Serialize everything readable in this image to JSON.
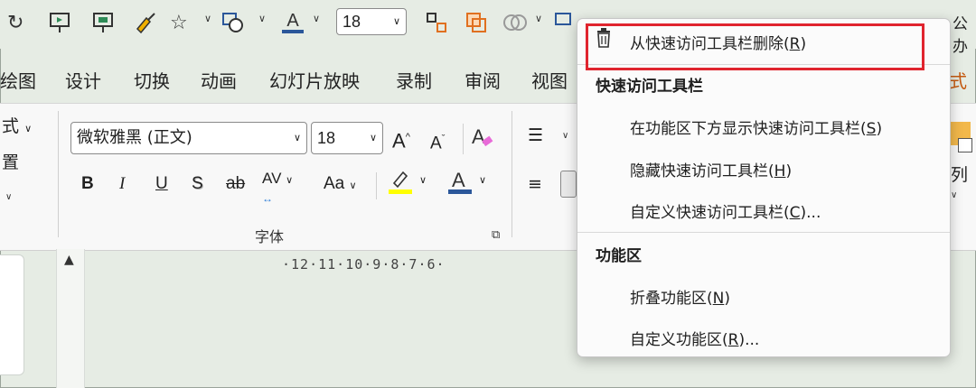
{
  "qat": {
    "font_size": "18",
    "icons": [
      "repeat-icon",
      "present-from-start-icon",
      "present-from-current-icon",
      "format-painter-icon",
      "shapes-icon",
      "shape-fill-icon",
      "font-color-icon",
      "arrange-icon",
      "bring-forward-icon",
      "merge-shapes-icon"
    ]
  },
  "tabs": {
    "items": [
      "绘图",
      "设计",
      "切换",
      "动画",
      "幻灯片放映",
      "录制",
      "审阅",
      "视图"
    ],
    "trailing": "式"
  },
  "ribbon": {
    "font_name": "微软雅黑 (正文)",
    "font_size": "18",
    "left_labels": [
      "式",
      "置"
    ],
    "bold": "B",
    "italic": "I",
    "underline": "U",
    "shadow": "S",
    "strike": "ab",
    "spacing": "AV",
    "case": "Aa",
    "grow_font": "A",
    "shrink_font": "A",
    "font_color": "A",
    "group_label": "字体",
    "right_label": "列"
  },
  "ruler": {
    "text": "·12·11·10·9·8·7·6·"
  },
  "top_right_text": "公办",
  "menu": {
    "item_remove": {
      "label": "从快速访问工具栏删除(",
      "key": "R",
      "suffix": ")"
    },
    "header_qat": "快速访问工具栏",
    "item_show_below": {
      "label": "在功能区下方显示快速访问工具栏(",
      "key": "S",
      "suffix": ")"
    },
    "item_hide": {
      "label": "隐藏快速访问工具栏(",
      "key": "H",
      "suffix": ")"
    },
    "item_customize_qat": {
      "label": "自定义快速访问工具栏(",
      "key": "C",
      "suffix": ")..."
    },
    "header_ribbon": "功能区",
    "item_collapse": {
      "label": "折叠功能区(",
      "key": "N",
      "suffix": ")"
    },
    "item_customize_ribbon": {
      "label": "自定义功能区(",
      "key": "R",
      "suffix": ")..."
    }
  },
  "colors": {
    "highlight_box": "#e0242e",
    "font_color_bar": "#2b579a",
    "highlighter_bar": "#ffff00"
  }
}
